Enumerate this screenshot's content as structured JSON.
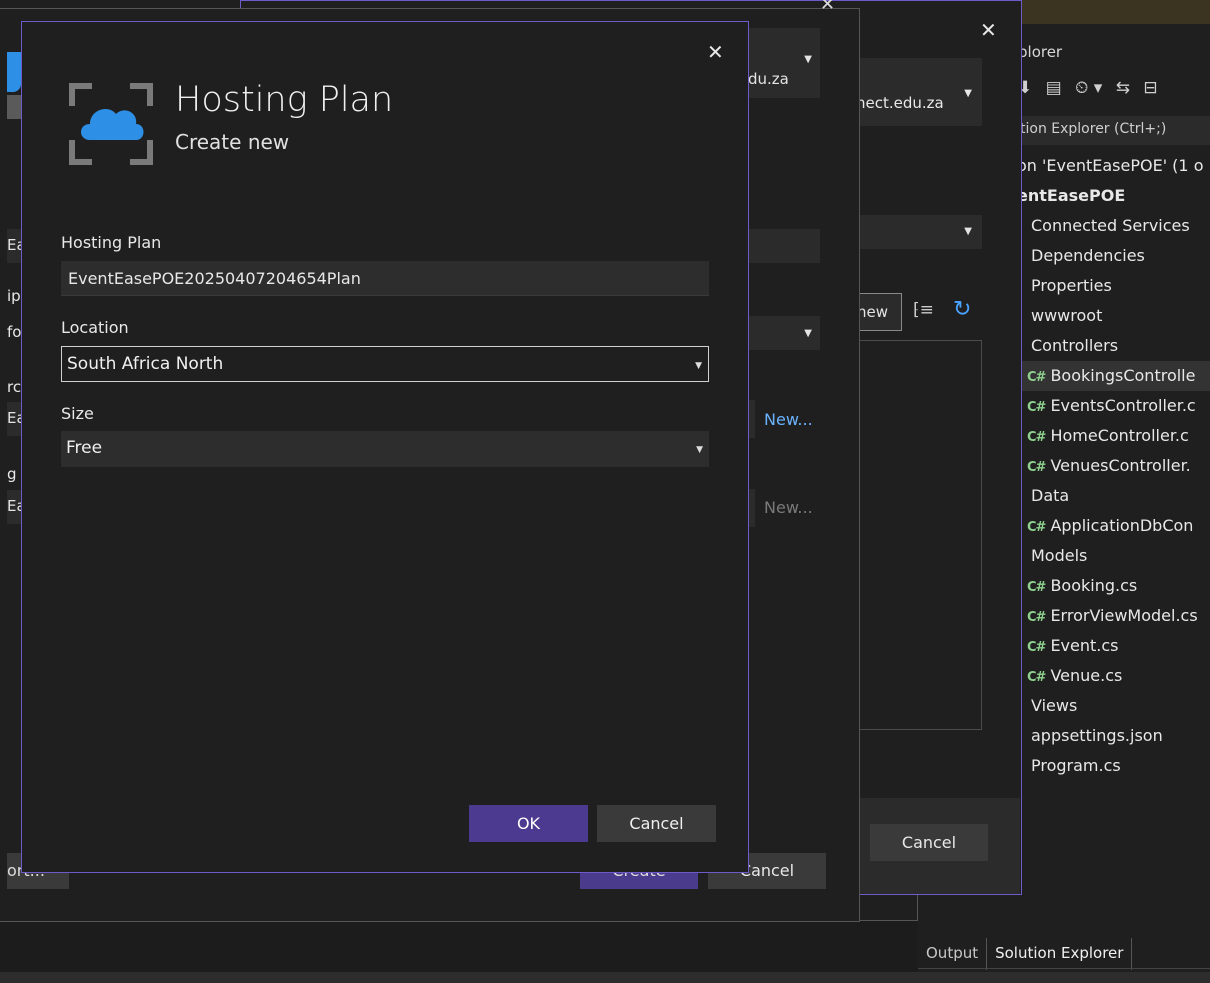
{
  "hosting_plan": {
    "title": "Hosting Plan",
    "subtitle": "Create new",
    "close_glyph": "✕",
    "fields": {
      "hosting_plan_label": "Hosting Plan",
      "hosting_plan_value": "EventEasePOE20250407204654Plan",
      "location_label": "Location",
      "location_value": "South Africa North",
      "size_label": "Size",
      "size_value": "Free"
    },
    "ok_label": "OK",
    "cancel_label": "Cancel"
  },
  "publish_dialog": {
    "account_drop_text": "du.za",
    "new_link_1": "New...",
    "new_link_2": "New...",
    "create_label": "Create",
    "cancel_label": "Cancel",
    "export_label": "ort...",
    "left_fragments": [
      "Ea",
      "ip",
      "fo",
      "rc",
      "Ea",
      "g",
      "Ea"
    ]
  },
  "back_dialog": {
    "account_text": "nect.edu.za",
    "new_button": "new",
    "cancel_label": "Cancel"
  },
  "solution_explorer": {
    "title": "plorer",
    "search_placeholder": "tion Explorer (Ctrl+;)",
    "items": [
      {
        "label": "on 'EventEasePOE' (1 o",
        "kind": "solution"
      },
      {
        "label": "entEasePOE",
        "kind": "project"
      },
      {
        "label": "Connected Services",
        "kind": "folder"
      },
      {
        "label": "Dependencies",
        "kind": "folder"
      },
      {
        "label": "Properties",
        "kind": "folder"
      },
      {
        "label": "wwwroot",
        "kind": "folder"
      },
      {
        "label": "Controllers",
        "kind": "folder"
      },
      {
        "label": "BookingsControlle",
        "kind": "cs",
        "selected": true
      },
      {
        "label": "EventsController.c",
        "kind": "cs"
      },
      {
        "label": "HomeController.c",
        "kind": "cs"
      },
      {
        "label": "VenuesController.",
        "kind": "cs"
      },
      {
        "label": "Data",
        "kind": "folder"
      },
      {
        "label": "ApplicationDbCon",
        "kind": "cs"
      },
      {
        "label": "Models",
        "kind": "folder"
      },
      {
        "label": "Booking.cs",
        "kind": "cs"
      },
      {
        "label": "ErrorViewModel.cs",
        "kind": "cs"
      },
      {
        "label": "Event.cs",
        "kind": "cs"
      },
      {
        "label": "Venue.cs",
        "kind": "cs"
      },
      {
        "label": "Views",
        "kind": "folder"
      },
      {
        "label": "appsettings.json",
        "kind": "file"
      },
      {
        "label": "Program.cs",
        "kind": "file"
      }
    ],
    "tabs": [
      "Output",
      "Solution Explorer"
    ],
    "active_tab": "Solution Explorer"
  },
  "colors": {
    "accent_purple": "#4b3a8f",
    "border_purple": "#6e5bc9",
    "cloud_blue": "#2e8fe6",
    "link_blue": "#6ab3ff"
  }
}
